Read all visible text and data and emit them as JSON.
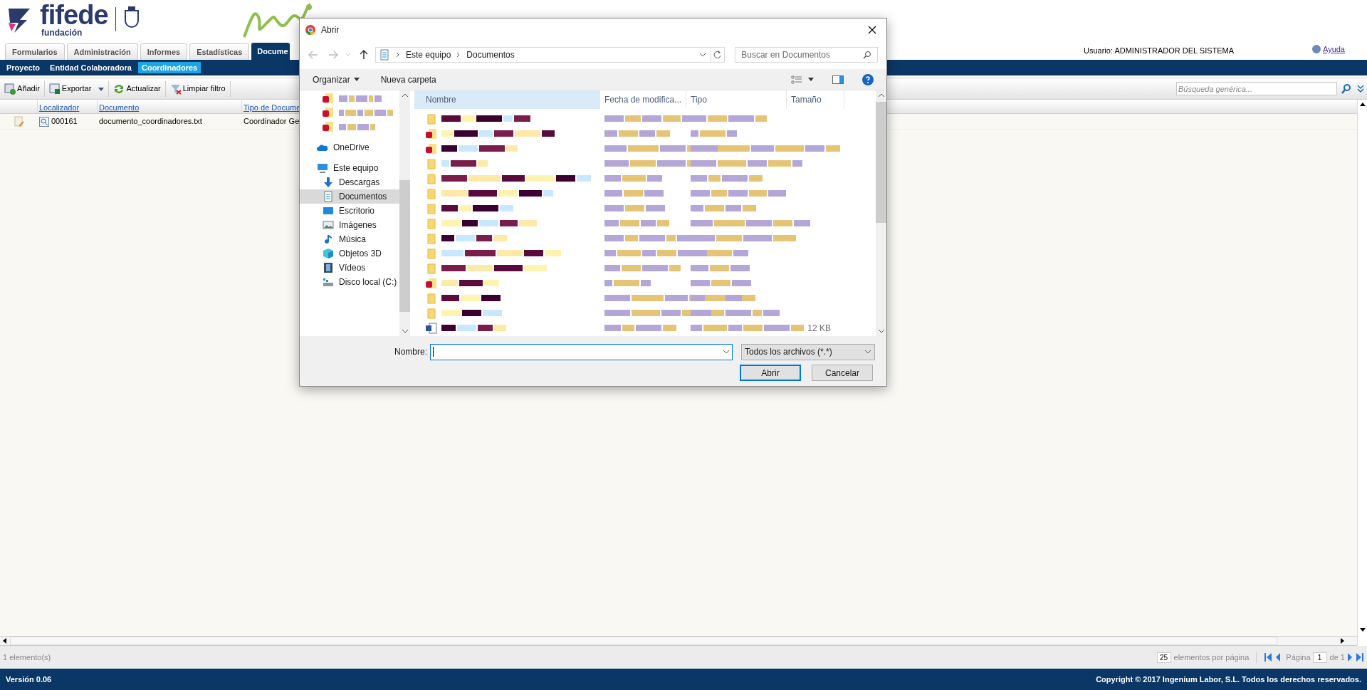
{
  "header": {
    "brand": "fifede",
    "brand_sub": "fundación",
    "user": "Usuario: ADMINISTRADOR DEL SISTEMA",
    "help": "Ayuda"
  },
  "tabs": [
    {
      "label": "Formularios",
      "selected": false
    },
    {
      "label": "Administración",
      "selected": false
    },
    {
      "label": "Informes",
      "selected": false
    },
    {
      "label": "Estadísticas",
      "selected": false
    },
    {
      "label": "Docume",
      "selected": true
    }
  ],
  "subnav": [
    {
      "label": "Proyecto",
      "selected": false
    },
    {
      "label": "Entidad Colaboradora",
      "selected": false
    },
    {
      "label": "Coordinadores",
      "selected": true
    }
  ],
  "toolbar": {
    "buttons": [
      {
        "kind": "add",
        "label": "Añadir"
      },
      {
        "kind": "export",
        "label": "Exportar"
      },
      {
        "kind": "refresh",
        "label": "Actualizar"
      },
      {
        "kind": "clear-filter",
        "label": "Limpiar filtro"
      }
    ],
    "search_placeholder": "Búsqueda genérica..."
  },
  "table": {
    "columns": [
      "Localizador",
      "Documento",
      "Tipo de Docume"
    ],
    "rows": [
      {
        "locator": "000161",
        "document": "documento_coordinadores.txt",
        "type": "Coordinador Ge"
      }
    ]
  },
  "status_bar": {
    "count": "1 elemento(s)",
    "page_size": "25",
    "page_size_label": "elementos por página",
    "page_label": "Página",
    "page": "1",
    "of": "de 1"
  },
  "footer": {
    "version": "Versión 0.06",
    "copyright": "Copyright © 2017 Ingenium Labor, S.L. Todos los derechos reservados."
  },
  "dialog": {
    "title": "Abrir",
    "path": [
      "Este equipo",
      "Documentos"
    ],
    "search_placeholder": "Buscar en Documentos",
    "organize": "Organizar",
    "new_folder": "Nueva carpeta",
    "nav": [
      {
        "kind": "pinned",
        "selected": false
      },
      {
        "kind": "pinned",
        "selected": false
      },
      {
        "kind": "pinned",
        "selected": false
      },
      {
        "kind": "cloud",
        "label": "OneDrive",
        "selected": false
      },
      {
        "kind": "computer",
        "label": "Este equipo",
        "selected": false
      },
      {
        "kind": "downloads",
        "label": "Descargas",
        "selected": false
      },
      {
        "kind": "documents",
        "label": "Documentos",
        "selected": true
      },
      {
        "kind": "desktop",
        "label": "Escritorio",
        "selected": false
      },
      {
        "kind": "images",
        "label": "Imágenes",
        "selected": false
      },
      {
        "kind": "music",
        "label": "Música",
        "selected": false
      },
      {
        "kind": "objects",
        "label": "Objetos 3D",
        "selected": false
      },
      {
        "kind": "videos",
        "label": "Vídeos",
        "selected": false
      },
      {
        "kind": "disk",
        "label": "Disco local (C:)",
        "selected": false
      }
    ],
    "columns": [
      "Nombre",
      "Fecha de modifica...",
      "Tipo",
      "Tamaño"
    ],
    "files": [
      {
        "kind": "folder"
      },
      {
        "kind": "pdf"
      },
      {
        "kind": "pdf"
      },
      {
        "kind": "folder"
      },
      {
        "kind": "folder"
      },
      {
        "kind": "folder"
      },
      {
        "kind": "folder"
      },
      {
        "kind": "folder"
      },
      {
        "kind": "folder"
      },
      {
        "kind": "folder"
      },
      {
        "kind": "folder"
      },
      {
        "kind": "pdf"
      },
      {
        "kind": "folder"
      },
      {
        "kind": "folder"
      },
      {
        "kind": "doc",
        "size": "12 KB"
      }
    ],
    "name_label": "Nombre:",
    "filter": "Todos los archivos (*.*)",
    "open": "Abrir",
    "cancel": "Cancelar"
  }
}
